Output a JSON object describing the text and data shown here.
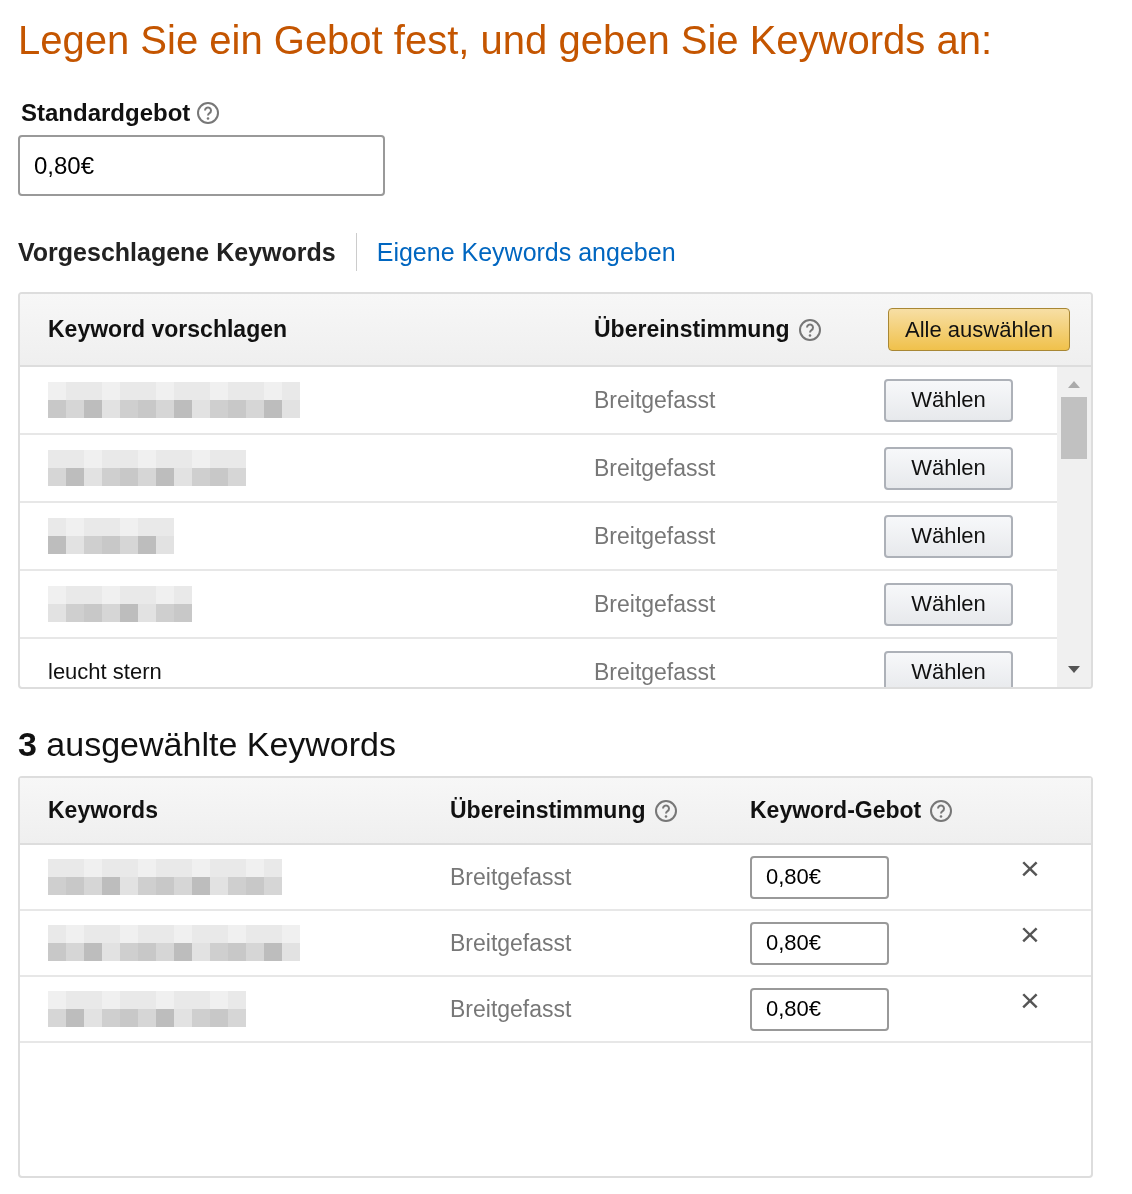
{
  "heading": "Legen Sie ein Gebot fest, und geben Sie Keywords an:",
  "default_bid": {
    "label": "Standardgebot",
    "value": "0,80€"
  },
  "tabs": [
    {
      "label": "Vorgeschlagene Keywords",
      "selected": true
    },
    {
      "label": "Eigene Keywords angeben",
      "selected": false
    }
  ],
  "suggested": {
    "columns": [
      "Keyword vorschlagen",
      "Übereinstimmung"
    ],
    "select_all": "Alle auswählen",
    "rows": [
      {
        "match": "Breitgefasst",
        "button": "Wählen"
      },
      {
        "match": "Breitgefasst",
        "button": "Wählen"
      },
      {
        "match": "Breitgefasst",
        "button": "Wählen"
      },
      {
        "match": "Breitgefasst",
        "button": "Wählen"
      },
      {
        "keyword": "leucht stern",
        "match": "Breitgefasst",
        "button": "Wählen"
      }
    ]
  },
  "selected": {
    "count": "3",
    "title": "ausgewählte Keywords",
    "columns": [
      "Keywords",
      "Übereinstimmung",
      "Keyword-Gebot"
    ],
    "rows": [
      {
        "match": "Breitgefasst",
        "bid": "0,80€",
        "remove": "×"
      },
      {
        "match": "Breitgefasst",
        "bid": "0,80€",
        "remove": "×"
      },
      {
        "match": "Breitgefasst",
        "bid": "0,80€",
        "remove": "×"
      }
    ]
  }
}
